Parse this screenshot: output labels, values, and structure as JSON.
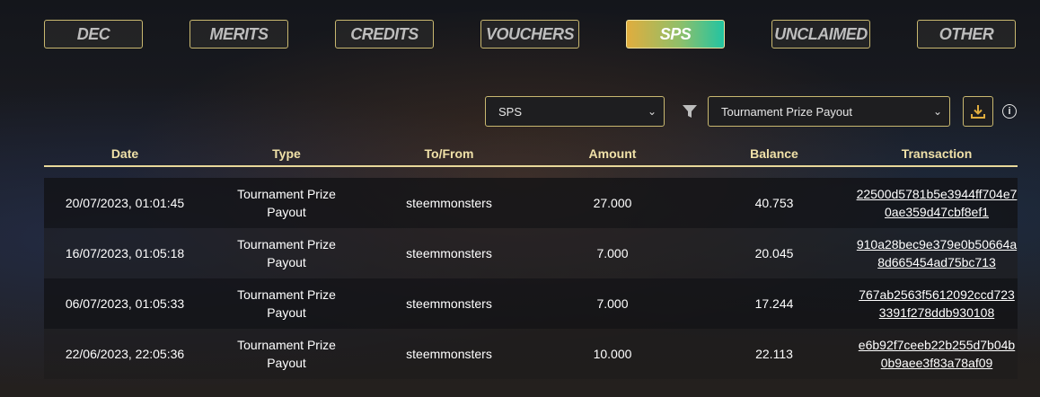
{
  "tabs": [
    {
      "label": "DEC",
      "active": false
    },
    {
      "label": "MERITS",
      "active": false
    },
    {
      "label": "CREDITS",
      "active": false
    },
    {
      "label": "VOUCHERS",
      "active": false
    },
    {
      "label": "SPS",
      "active": true
    },
    {
      "label": "UNCLAIMED",
      "active": false
    },
    {
      "label": "OTHER",
      "active": false
    }
  ],
  "controls": {
    "token_select": "SPS",
    "type_filter": "Tournament Prize Payout",
    "icons": [
      "filter-icon",
      "download-icon",
      "info-icon"
    ]
  },
  "table": {
    "headers": [
      "Date",
      "Type",
      "To/From",
      "Amount",
      "Balance",
      "Transaction"
    ],
    "rows": [
      {
        "date": "20/07/2023, 01:01:45",
        "type": "Tournament Prize Payout",
        "to_from": "steemmonsters",
        "amount": "27.000",
        "balance": "40.753",
        "tx": "22500d5781b5e3944ff704e70ae359d47cbf8ef1"
      },
      {
        "date": "16/07/2023, 01:05:18",
        "type": "Tournament Prize Payout",
        "to_from": "steemmonsters",
        "amount": "7.000",
        "balance": "20.045",
        "tx": "910a28bec9e379e0b50664a8d665454ad75bc713"
      },
      {
        "date": "06/07/2023, 01:05:33",
        "type": "Tournament Prize Payout",
        "to_from": "steemmonsters",
        "amount": "7.000",
        "balance": "17.244",
        "tx": "767ab2563f5612092ccd7233391f278ddb930108"
      },
      {
        "date": "22/06/2023, 22:05:36",
        "type": "Tournament Prize Payout",
        "to_from": "steemmonsters",
        "amount": "10.000",
        "balance": "22.113",
        "tx": "e6b92f7ceeb22b255d7b04b0b9aee3f83a78af09"
      }
    ]
  },
  "colors": {
    "accent_gold": "#c9b870",
    "header_text": "#f0e1a8",
    "active_tab_start": "#e0ad3e",
    "active_tab_end": "#22c4a2"
  }
}
